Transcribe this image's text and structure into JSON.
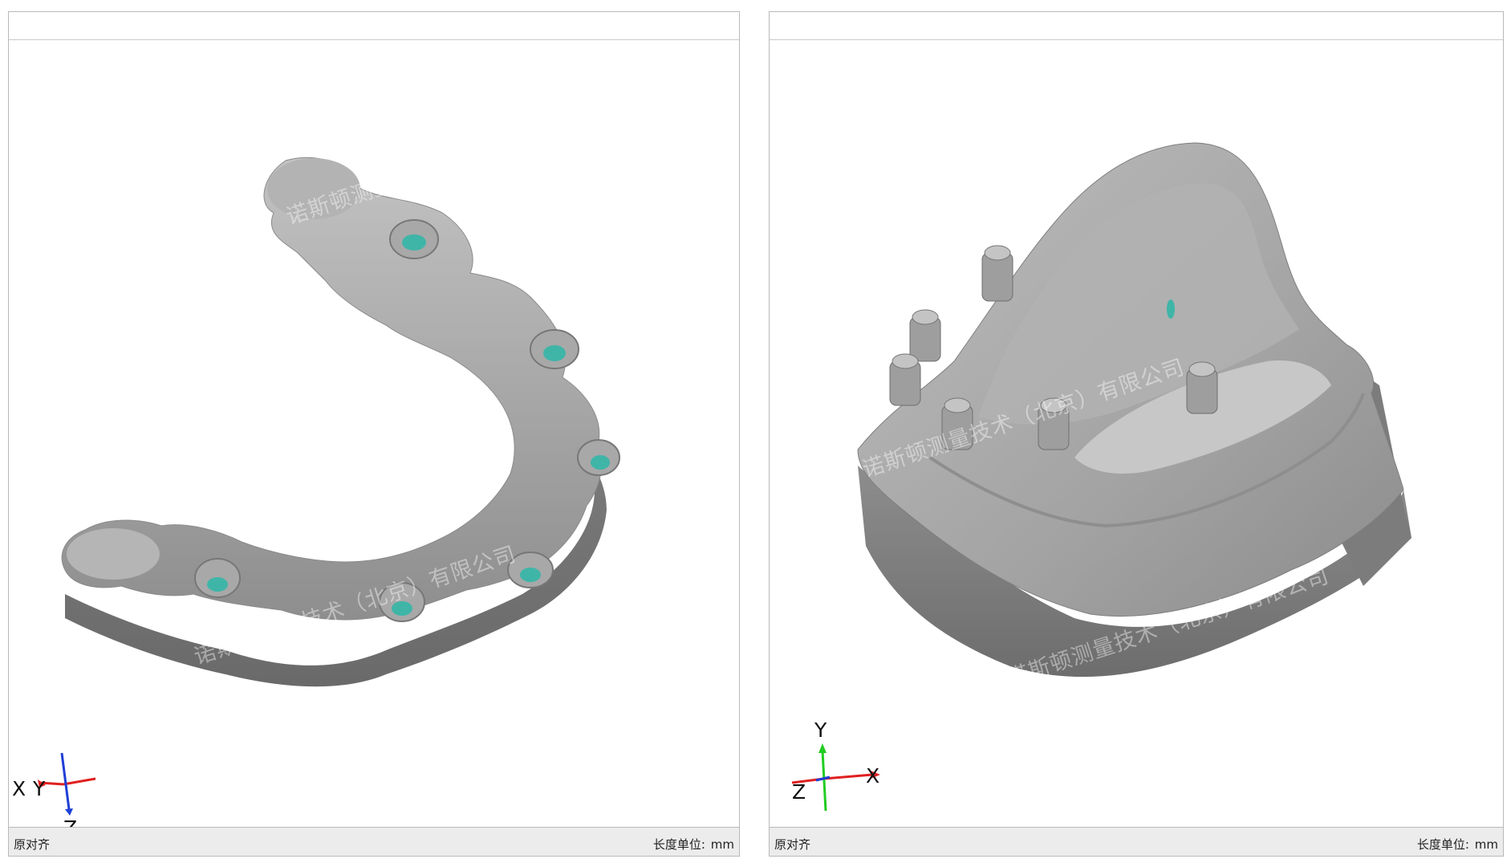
{
  "viewports": [
    {
      "id": "left",
      "status_left": "原对齐",
      "unit_label": "长度单位:",
      "unit_value": "mm",
      "watermarks": [
        "诺斯顿测量技术",
        "诺斯顿测量技术（北京）有限公司"
      ],
      "axes": {
        "x": "X",
        "y": "Y",
        "z": "Z"
      }
    },
    {
      "id": "right",
      "status_left": "原对齐",
      "unit_label": "长度单位:",
      "unit_value": "mm",
      "watermarks": [
        "诺斯顿测量技术（北京）有限公司",
        "诺斯顿测量技术（北京）有限公司"
      ],
      "axes": {
        "x": "X",
        "y": "Y",
        "z": "Z"
      }
    }
  ],
  "colors": {
    "model_gray": "#9a9a9a",
    "model_dark": "#6f6f6f",
    "model_light": "#c4c4c4",
    "implant_cyan": "#3fb5a8",
    "axis_red": "#e02020",
    "axis_blue": "#1f3fd6",
    "axis_green": "#22cc22"
  },
  "icons": [
    "axis-triad-icon"
  ]
}
